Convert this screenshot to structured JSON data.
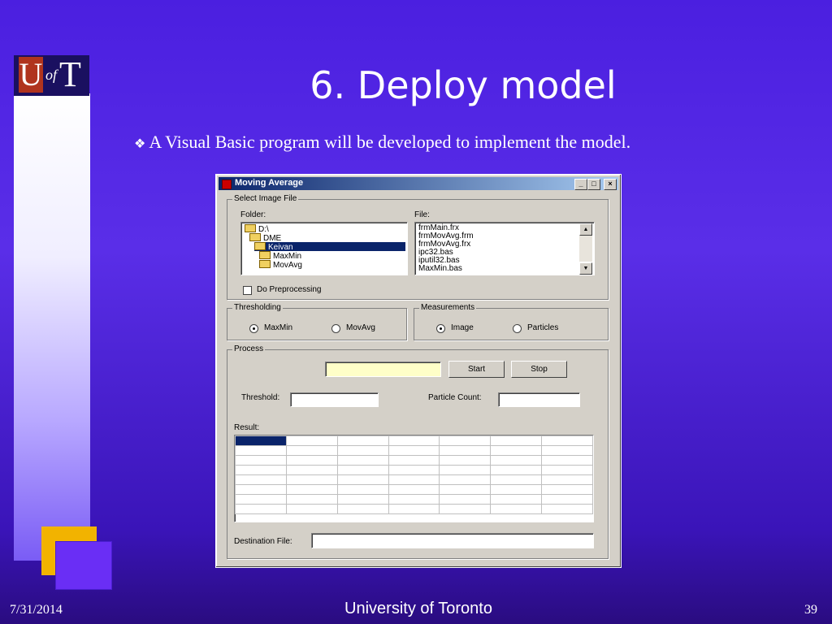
{
  "slide": {
    "title": "6. Deploy model",
    "bullet": "A Visual Basic program will be developed to implement the model.",
    "bullet_marker": "❖",
    "footer_date": "7/31/2014",
    "footer_center": "University of Toronto",
    "page_number": "39",
    "logo": {
      "u": "U",
      "of": "of",
      "t": "T"
    }
  },
  "window": {
    "title": "Moving Average",
    "controls": {
      "minimize": "_",
      "maximize": "□",
      "close": "×"
    },
    "select_image_group": "Select Image File",
    "folder_label": "Folder:",
    "file_label": "File:",
    "folders": [
      "D:\\",
      "DME",
      "Keivan",
      "MaxMin",
      "MovAvg"
    ],
    "selected_folder": "Keivan",
    "files": [
      "frmMain.frx",
      "frmMovAvg.frm",
      "frmMovAvg.frx",
      "ipc32.bas",
      "iputil32.bas",
      "MaxMin.bas"
    ],
    "preprocess_label": "Do Preprocessing",
    "thresholding_group": "Thresholding",
    "thresholding_options": [
      "MaxMin",
      "MovAvg"
    ],
    "thresholding_selected": "MaxMin",
    "measurements_group": "Measurements",
    "measurements_options": [
      "Image",
      "Particles"
    ],
    "measurements_selected": "Image",
    "process_group": "Process",
    "start_label": "Start",
    "stop_label": "Stop",
    "threshold_label": "Threshold:",
    "particle_count_label": "Particle Count:",
    "result_label": "Result:",
    "destination_label": "Destination File:"
  }
}
